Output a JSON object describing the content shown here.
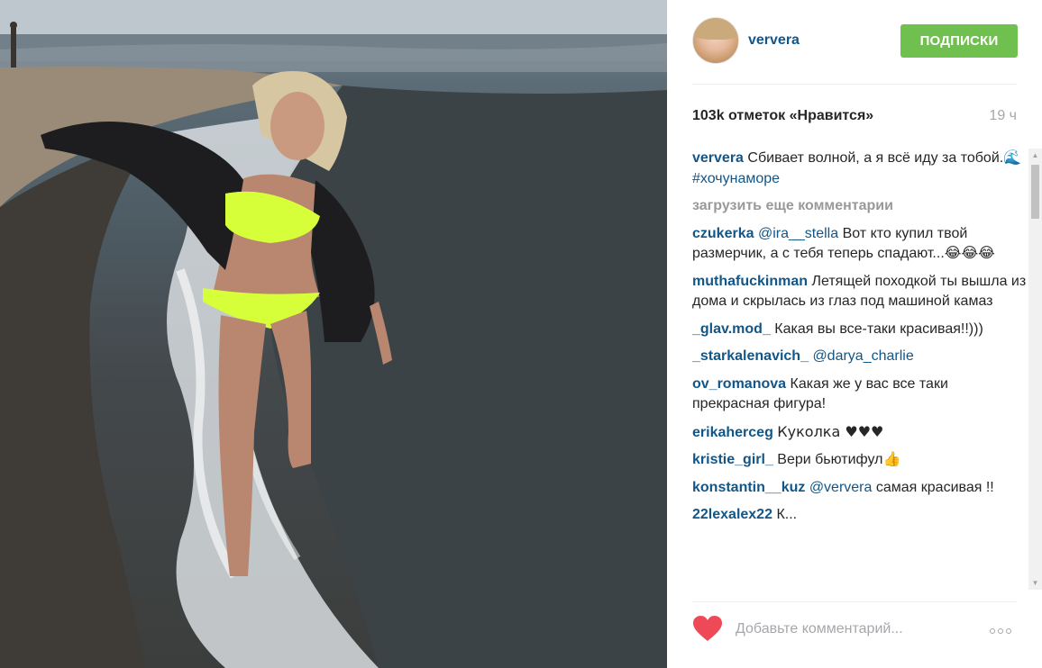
{
  "post": {
    "photo_alt": "",
    "author": "ververa",
    "follow_label": "ПОДПИСКИ",
    "likes_text": "103k отметок «Нравится»",
    "time_ago": "19 ч"
  },
  "caption": {
    "user": "ververa",
    "text": "Сбивает волной, а я всё иду за тобой.",
    "emoji": "🌊",
    "tag": "#хочунаморе"
  },
  "load_more_label": "загрузить еще комментарии",
  "comments": [
    {
      "user": "czukerka",
      "mention": "@ira__stella",
      "text": "Вот кто купил твой размерчик, а с тебя теперь спадают...😂😂😂"
    },
    {
      "user": "muthafuckinman",
      "mention": "",
      "text": "Летящей походкой ты вышла из дома и скрылась из глаз под машиной камаз"
    },
    {
      "user": "_glav.mod_",
      "mention": "",
      "text": "Какая вы все-таки красивая!!)))"
    },
    {
      "user": "_starkalenavich_",
      "mention": "@darya_charlie",
      "text": ""
    },
    {
      "user": "ov_romanova",
      "mention": "",
      "text": "Какая же у вас все таки прекрасная фигура!"
    },
    {
      "user": "erikaherceg",
      "mention": "",
      "text": "Куколка ♥♥♥"
    },
    {
      "user": "kristie_girl_",
      "mention": "",
      "text": "Вери бьютифул👍"
    },
    {
      "user": "konstantin__kuz",
      "mention": "@ververa",
      "text": "самая красивая !!"
    },
    {
      "user": "22lexalex22",
      "mention": "",
      "text": "К..."
    }
  ],
  "footer": {
    "comment_placeholder": "Добавьте комментарий...",
    "like_icon": "heart-icon",
    "more_icon": "ellipsis-icon"
  },
  "colors": {
    "username_blue": "#125688",
    "follow_green": "#70c050",
    "heart_red": "#ed4956",
    "muted_gray": "#a5a7aa"
  }
}
